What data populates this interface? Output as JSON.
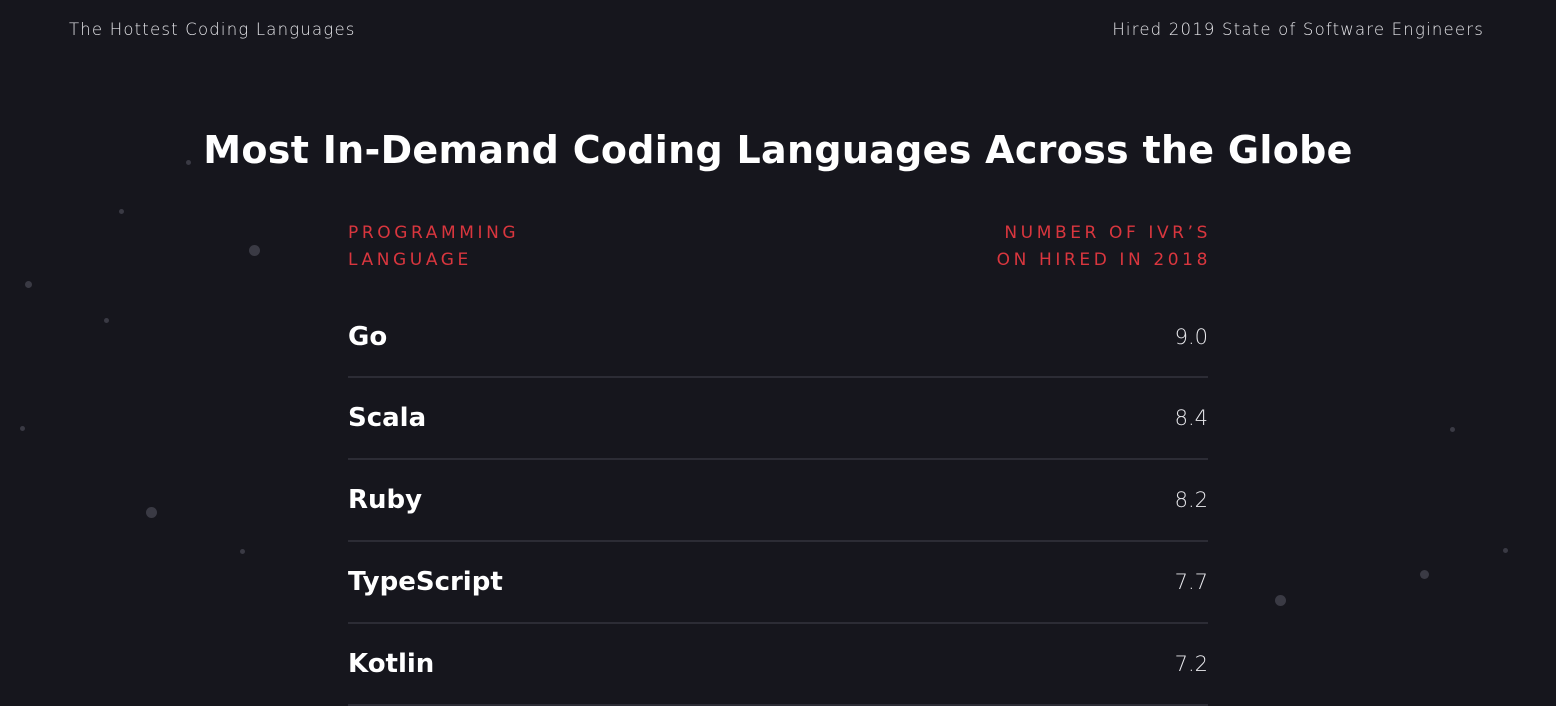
{
  "header": {
    "left": "The Hottest Coding Languages",
    "right": "Hired 2019 State of Software Engineers"
  },
  "title": "Most In-Demand Coding Languages Across the Globe",
  "table": {
    "col1": [
      "PROGRAMMING",
      "LANGUAGE"
    ],
    "col2": [
      "NUMBER OF IVR’S",
      "ON HIRED IN 2018"
    ],
    "rows": [
      {
        "language": "Go",
        "value": "9.0"
      },
      {
        "language": "Scala",
        "value": "8.4"
      },
      {
        "language": "Ruby",
        "value": "8.2"
      },
      {
        "language": "TypeScript",
        "value": "7.7"
      },
      {
        "language": "Kotlin",
        "value": "7.2"
      }
    ]
  },
  "colors": {
    "background": "#16161d",
    "accent": "#d9363e",
    "divider": "#2c2c35"
  }
}
